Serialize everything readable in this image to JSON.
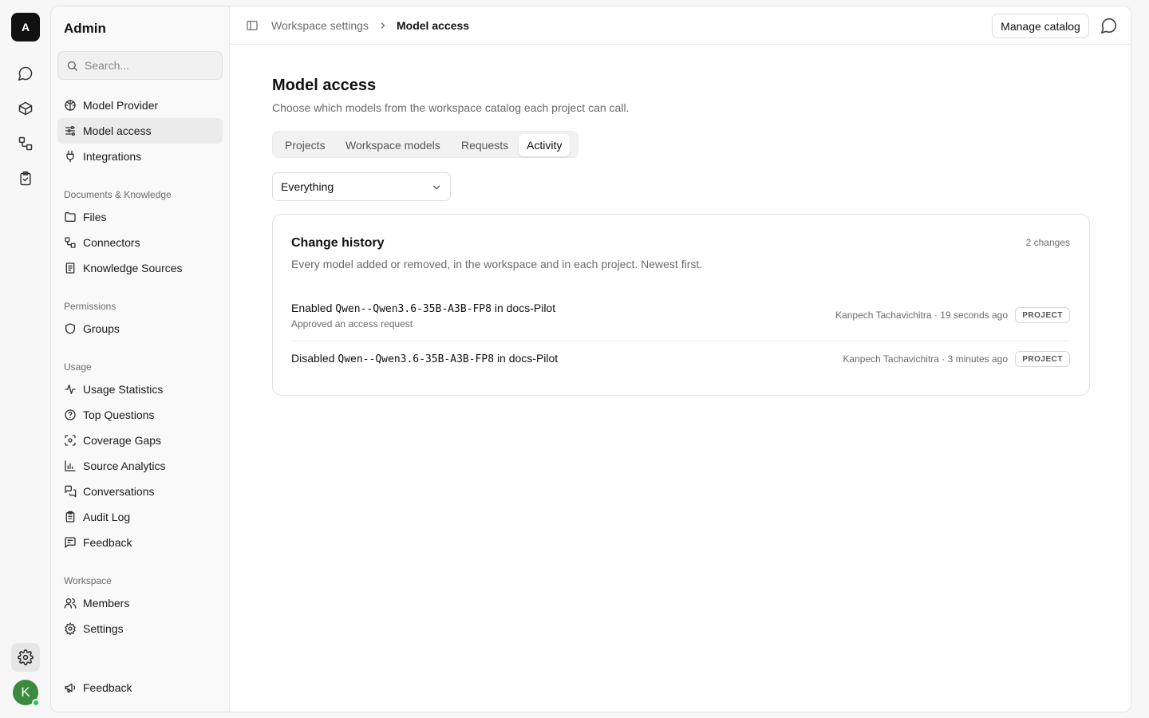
{
  "rail": {
    "logo_letter": "A",
    "avatar_letter": "K"
  },
  "sidebar": {
    "title": "Admin",
    "search_placeholder": "Search...",
    "top_items": [
      {
        "label": "Model Provider",
        "icon": "brain-icon"
      },
      {
        "label": "Model access",
        "icon": "sliders-icon",
        "active": true
      },
      {
        "label": "Integrations",
        "icon": "plug-icon"
      }
    ],
    "sections": [
      {
        "title": "Documents & Knowledge",
        "items": [
          {
            "label": "Files",
            "icon": "folder-icon"
          },
          {
            "label": "Connectors",
            "icon": "connector-icon"
          },
          {
            "label": "Knowledge Sources",
            "icon": "book-icon"
          }
        ]
      },
      {
        "title": "Permissions",
        "items": [
          {
            "label": "Groups",
            "icon": "shield-icon"
          }
        ]
      },
      {
        "title": "Usage",
        "items": [
          {
            "label": "Usage Statistics",
            "icon": "activity-icon"
          },
          {
            "label": "Top Questions",
            "icon": "question-icon"
          },
          {
            "label": "Coverage Gaps",
            "icon": "scan-icon"
          },
          {
            "label": "Source Analytics",
            "icon": "bar-chart-icon"
          },
          {
            "label": "Conversations",
            "icon": "messages-icon"
          },
          {
            "label": "Audit Log",
            "icon": "clipboard-icon"
          },
          {
            "label": "Feedback",
            "icon": "message-square-icon"
          }
        ]
      },
      {
        "title": "Workspace",
        "items": [
          {
            "label": "Members",
            "icon": "users-icon"
          },
          {
            "label": "Settings",
            "icon": "gear-icon"
          }
        ]
      }
    ],
    "footer_item": {
      "label": "Feedback",
      "icon": "megaphone-icon"
    }
  },
  "topbar": {
    "breadcrumb_parent": "Workspace settings",
    "breadcrumb_current": "Model access",
    "manage_label": "Manage catalog"
  },
  "main": {
    "title": "Model access",
    "subtitle": "Choose which models from the workspace catalog each project can call.",
    "tabs": [
      {
        "label": "Projects"
      },
      {
        "label": "Workspace models"
      },
      {
        "label": "Requests"
      },
      {
        "label": "Activity",
        "active": true
      }
    ],
    "filter_value": "Everything",
    "history": {
      "title": "Change history",
      "count": "2 changes",
      "subtitle": "Every model added or removed, in the workspace and in each project. Newest first.",
      "rows": [
        {
          "action": "Enabled",
          "model": "Qwen--Qwen3.6-35B-A3B-FP8",
          "target": "in docs-Pilot",
          "note": "Approved an access request",
          "meta": "Kanpech Tachavichitra · 19 seconds ago",
          "badge": "PROJECT"
        },
        {
          "action": "Disabled",
          "model": "Qwen--Qwen3.6-35B-A3B-FP8",
          "target": "in docs-Pilot",
          "note": "",
          "meta": "Kanpech Tachavichitra · 3 minutes ago",
          "badge": "PROJECT"
        }
      ]
    }
  }
}
